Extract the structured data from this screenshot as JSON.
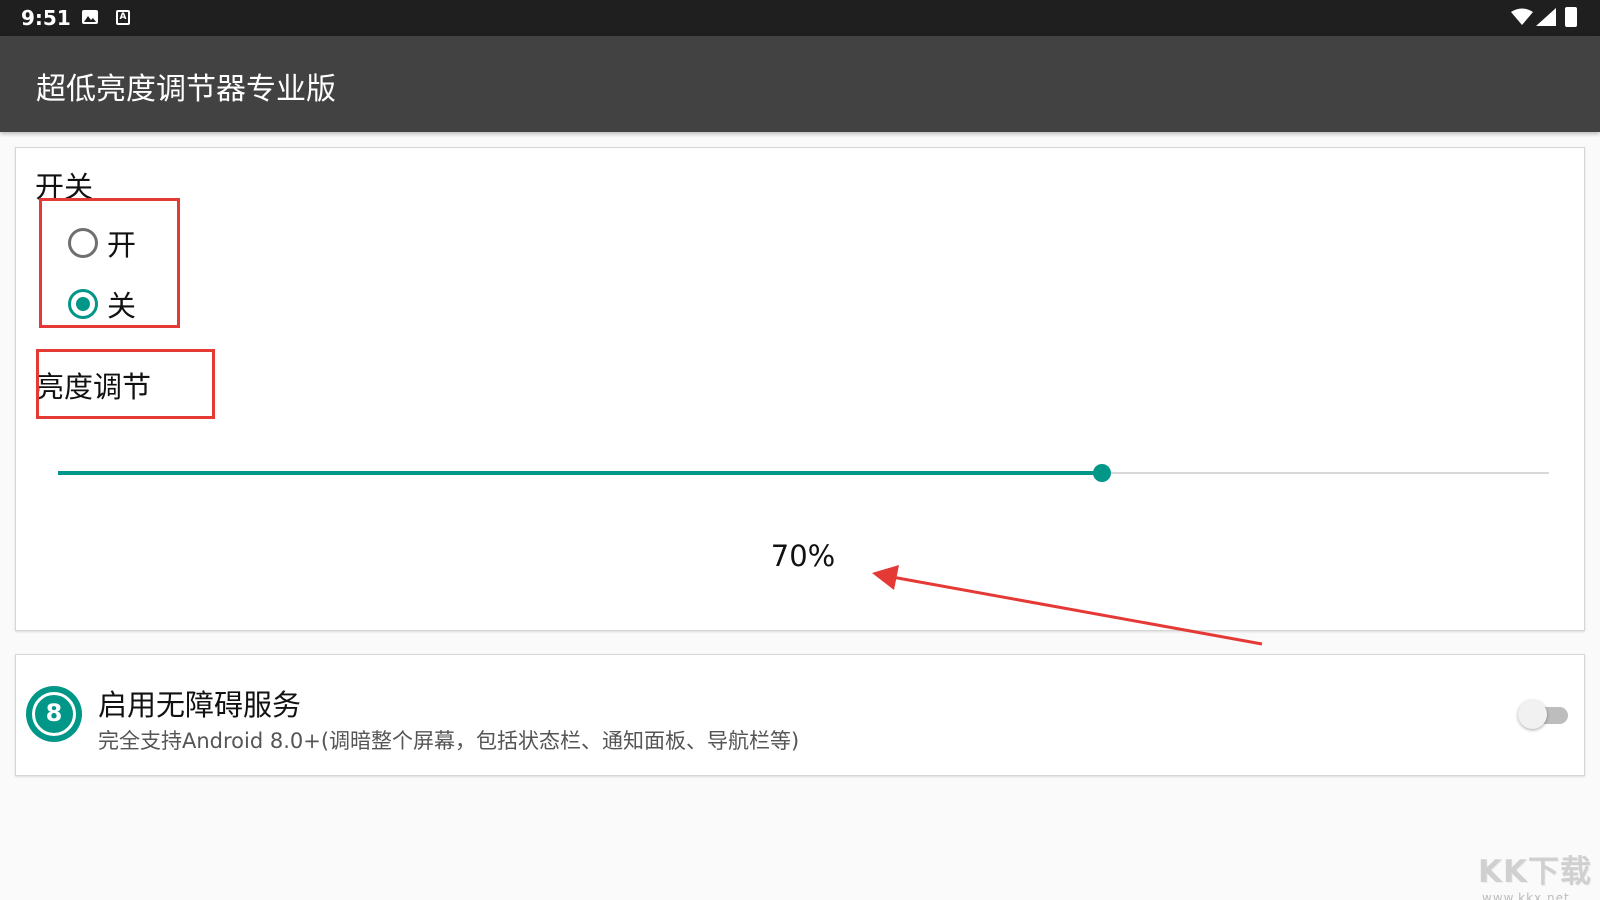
{
  "status_bar": {
    "time": "9:51",
    "icons": [
      "image-icon",
      "a-notification-icon",
      "wifi-icon",
      "signal-icon",
      "battery-icon"
    ],
    "a_glyph": "A"
  },
  "app_bar": {
    "title": "超低亮度调节器专业版"
  },
  "switch_section": {
    "label": "开关",
    "options": [
      {
        "label": "开",
        "checked": false
      },
      {
        "label": "关",
        "checked": true
      }
    ]
  },
  "brightness_section": {
    "label": "亮度调节",
    "slider_value": 0.7,
    "percent_text": "70%"
  },
  "accessibility": {
    "icon": "accessibility-8-icon",
    "icon_text": "8",
    "title": "启用无障碍服务",
    "subtitle": "完全支持Android 8.0+(调暗整个屏幕，包括状态栏、通知面板、导航栏等)",
    "toggle_on": false
  },
  "watermark": {
    "logo": "KK下载",
    "url": "www.kkx.net"
  },
  "colors": {
    "accent": "#009688",
    "app_bar": "#424242",
    "status_bar": "#1f1f1f",
    "annotation_red": "#e53935"
  }
}
